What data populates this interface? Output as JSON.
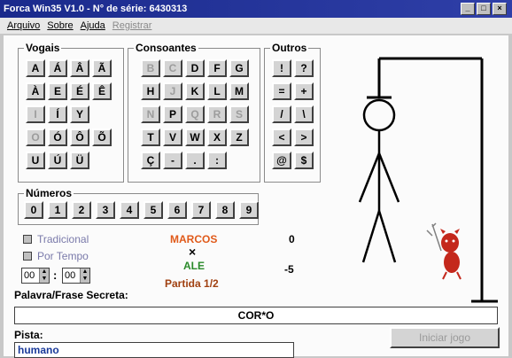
{
  "window": {
    "title": "Forca Win35 V1.0 - N° de série: 6430313"
  },
  "menu": {
    "arquivo": "Arquivo",
    "sobre": "Sobre",
    "ajuda": "Ajuda",
    "registrar": "Registrar"
  },
  "groups": {
    "vogais": "Vogais",
    "consoantes": "Consoantes",
    "outros": "Outros",
    "numeros": "Números"
  },
  "keys": {
    "vogais": [
      "A",
      "Á",
      "Â",
      "Ã",
      "À",
      "E",
      "É",
      "Ê",
      "I",
      "Í",
      "Y",
      "O",
      "Ó",
      "Ô",
      "Õ",
      "U",
      "Ú",
      "Ü"
    ],
    "consoantes": [
      "B",
      "C",
      "D",
      "F",
      "G",
      "H",
      "J",
      "K",
      "L",
      "M",
      "N",
      "P",
      "Q",
      "R",
      "S",
      "T",
      "V",
      "W",
      "X",
      "Z",
      "Ç",
      "-",
      ".",
      ":"
    ],
    "outros": [
      "!",
      "?",
      "=",
      "+",
      "/",
      "\\",
      "<",
      ">",
      "@",
      "$"
    ],
    "numeros": [
      "0",
      "1",
      "2",
      "3",
      "4",
      "5",
      "6",
      "7",
      "8",
      "9"
    ]
  },
  "modes": {
    "tradicional": "Tradicional",
    "por_tempo": "Por Tempo"
  },
  "timer": {
    "minutes": "00",
    "sep": ":",
    "seconds": "00"
  },
  "players": {
    "p1_name": "MARCOS",
    "p1_score": "0",
    "vs": "×",
    "p2_name": "ALE",
    "p2_score": "-5",
    "round": "Partida 1/2"
  },
  "secret": {
    "label": "Palavra/Frase Secreta:",
    "value": "COR*O"
  },
  "hint": {
    "label": "Pista:",
    "value": "humano"
  },
  "actions": {
    "start": "Iniciar jogo"
  }
}
